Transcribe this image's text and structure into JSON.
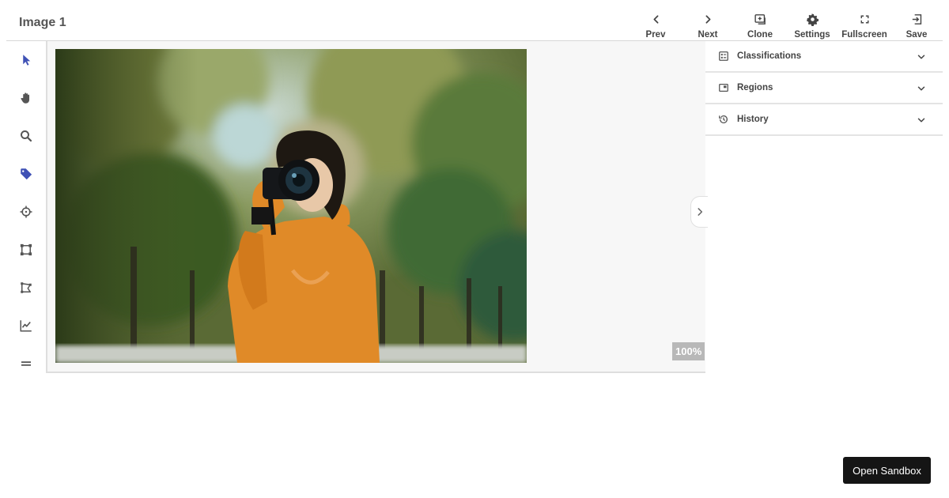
{
  "header": {
    "title": "Image 1"
  },
  "toolbar": {
    "items": [
      {
        "label": "Prev",
        "icon": "chevron-left-icon"
      },
      {
        "label": "Next",
        "icon": "chevron-right-icon"
      },
      {
        "label": "Clone",
        "icon": "clone-icon"
      },
      {
        "label": "Settings",
        "icon": "gear-icon"
      },
      {
        "label": "Fullscreen",
        "icon": "fullscreen-icon"
      },
      {
        "label": "Save",
        "icon": "exit-icon"
      }
    ]
  },
  "left_tools": [
    {
      "icon": "pointer-icon",
      "active": true
    },
    {
      "icon": "hand-icon",
      "active": false
    },
    {
      "icon": "search-icon",
      "active": false
    },
    {
      "icon": "tag-icon",
      "active": true
    },
    {
      "icon": "crosshair-icon",
      "active": false
    },
    {
      "icon": "bounding-box-icon",
      "active": false
    },
    {
      "icon": "polygon-icon",
      "active": false
    },
    {
      "icon": "line-chart-icon",
      "active": false
    },
    {
      "icon": "equals-icon",
      "active": false
    }
  ],
  "canvas": {
    "zoom_label": "100%"
  },
  "panel": {
    "items": [
      {
        "label": "Classifications",
        "icon": "list-icon"
      },
      {
        "label": "Regions",
        "icon": "region-icon"
      },
      {
        "label": "History",
        "icon": "history-icon"
      }
    ]
  },
  "sandbox": {
    "label": "Open Sandbox"
  },
  "colors": {
    "accent": "#3f51b5",
    "icon": "#555555",
    "dark_button": "#151515"
  }
}
